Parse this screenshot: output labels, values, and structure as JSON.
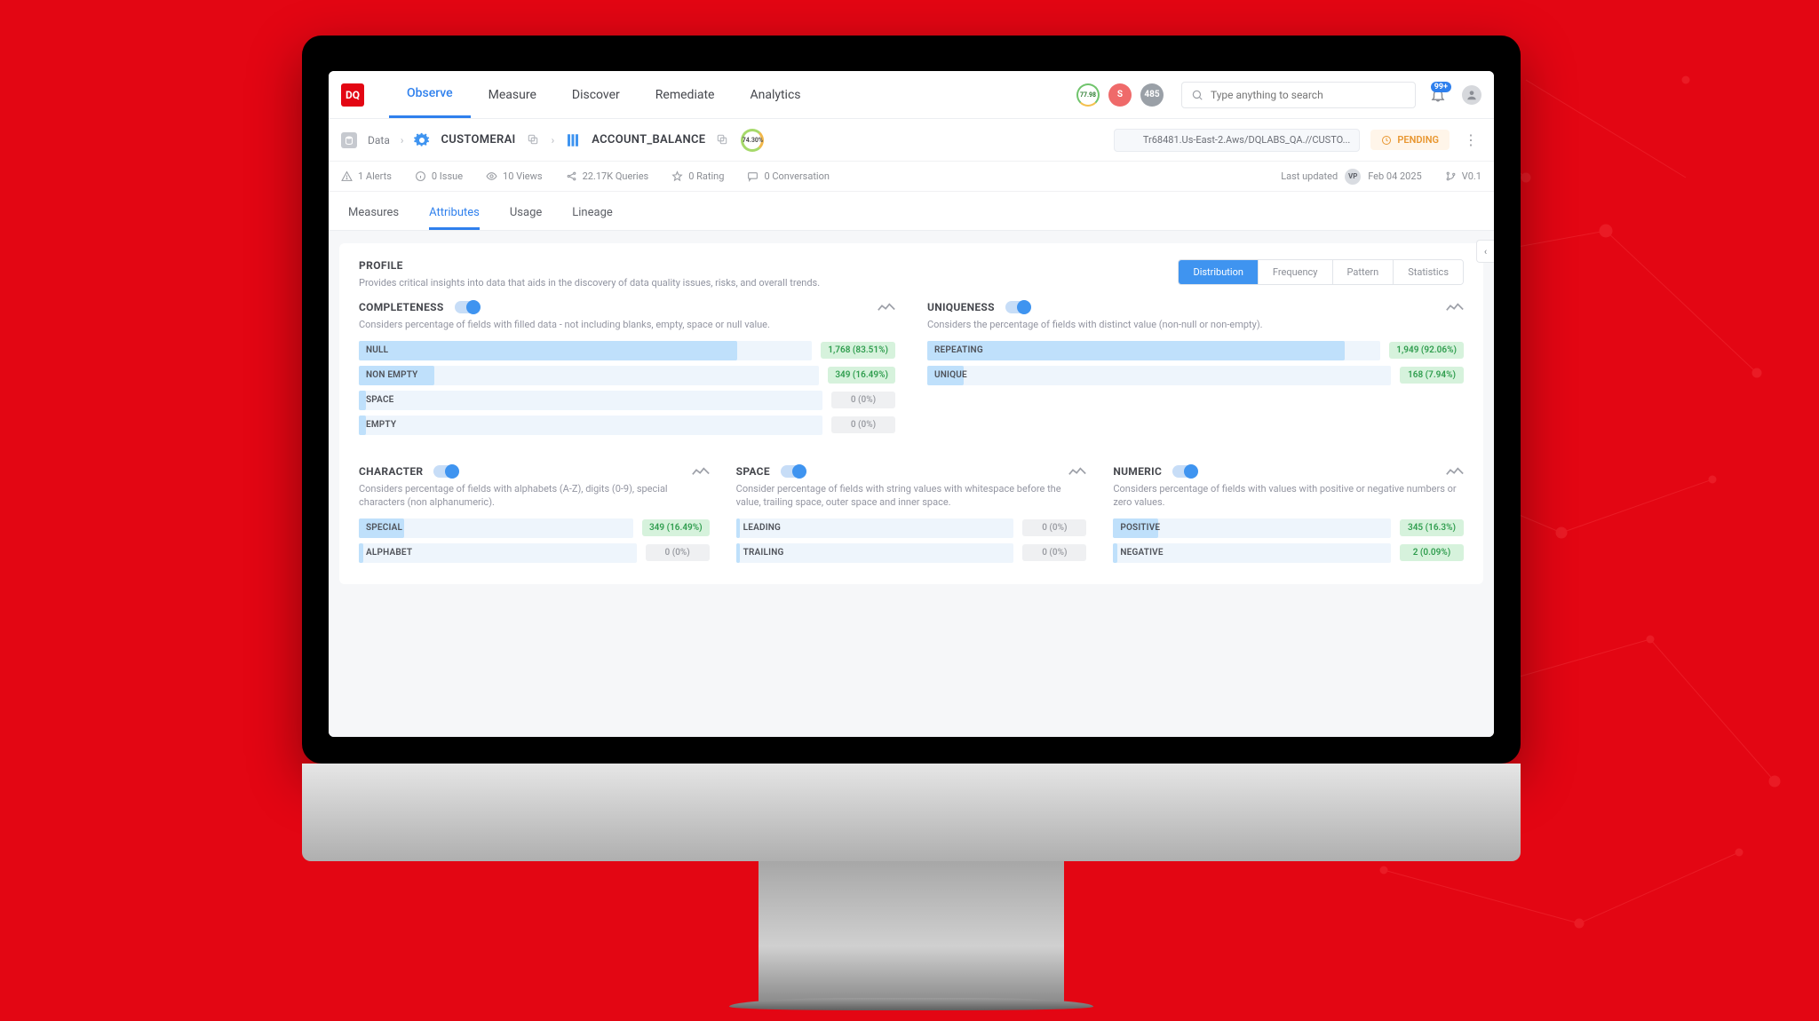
{
  "logo": "DQ",
  "nav": {
    "observe": "Observe",
    "measure": "Measure",
    "discover": "Discover",
    "remediate": "Remediate",
    "analytics": "Analytics"
  },
  "topbadges": {
    "ring": "77.98",
    "badge1": "S",
    "badge2": "485"
  },
  "search": {
    "placeholder": "Type anything to search"
  },
  "bell": {
    "count": "99+"
  },
  "crumb": {
    "data": "Data",
    "customerai": "CUSTOMERAI",
    "account": "ACCOUNT_BALANCE",
    "ring": "74.30%"
  },
  "path": "Tr68481.Us-East-2.Aws/DQLABS_QA.//CUSTO...",
  "pending": "PENDING",
  "stats": {
    "alerts": "1 Alerts",
    "issue": "0 Issue",
    "views": "10 Views",
    "queries": "22.17K Queries",
    "rating": "0  Rating",
    "conv": "0 Conversation",
    "updated": "Last updated",
    "vp": "VP",
    "date": "Feb 04 2025",
    "ver": "V0.1"
  },
  "subtabs": {
    "measures": "Measures",
    "attributes": "Attributes",
    "usage": "Usage",
    "lineage": "Lineage"
  },
  "profile": {
    "title": "PROFILE",
    "sub": "Provides critical insights into data that aids in the discovery of data quality issues, risks, and overall trends."
  },
  "seg": {
    "dist": "Distribution",
    "freq": "Frequency",
    "pat": "Pattern",
    "stat": "Statistics"
  },
  "completeness": {
    "title": "COMPLETENESS",
    "desc": "Considers percentage of fields with filled data - not including blanks, empty, space or null value.",
    "rows": [
      {
        "label": "NULL",
        "pct": 83.51,
        "pill": "1,768 (83.51%)",
        "gray": false
      },
      {
        "label": "NON EMPTY",
        "pct": 16.49,
        "pill": "349 (16.49%)",
        "gray": false
      },
      {
        "label": "SPACE",
        "pct": 0,
        "pill": "0 (0%)",
        "gray": true
      },
      {
        "label": "EMPTY",
        "pct": 0,
        "pill": "0 (0%)",
        "gray": true
      }
    ]
  },
  "uniqueness": {
    "title": "UNIQUENESS",
    "desc": "Considers the percentage of fields with distinct value (non-null or non-empty).",
    "rows": [
      {
        "label": "REPEATING",
        "pct": 92.06,
        "pill": "1,949 (92.06%)",
        "gray": false
      },
      {
        "label": "UNIQUE",
        "pct": 7.94,
        "pill": "168 (7.94%)",
        "gray": false
      }
    ]
  },
  "character": {
    "title": "CHARACTER",
    "desc": "Considers percentage of fields with alphabets (A-Z), digits (0-9), special characters (non alphanumeric).",
    "rows": [
      {
        "label": "SPECIAL",
        "pct": 16.49,
        "pill": "349 (16.49%)",
        "gray": false
      },
      {
        "label": "ALPHABET",
        "pct": 0,
        "pill": "0 (0%)",
        "gray": true
      }
    ]
  },
  "space": {
    "title": "SPACE",
    "desc": "Consider percentage of fields with string values with whitespace before the value, trailing space, outer space and inner space.",
    "rows": [
      {
        "label": "LEADING",
        "pct": 0,
        "pill": "0 (0%)",
        "gray": true
      },
      {
        "label": "TRAILING",
        "pct": 0,
        "pill": "0 (0%)",
        "gray": true
      }
    ]
  },
  "numeric": {
    "title": "NUMERIC",
    "desc": "Considers percentage of fields with values with positive or negative numbers or zero values.",
    "rows": [
      {
        "label": "POSITIVE",
        "pct": 16.3,
        "pill": "345 (16.3%)",
        "gray": false
      },
      {
        "label": "NEGATIVE",
        "pct": 0.09,
        "pill": "2 (0.09%)",
        "gray": false
      }
    ]
  }
}
